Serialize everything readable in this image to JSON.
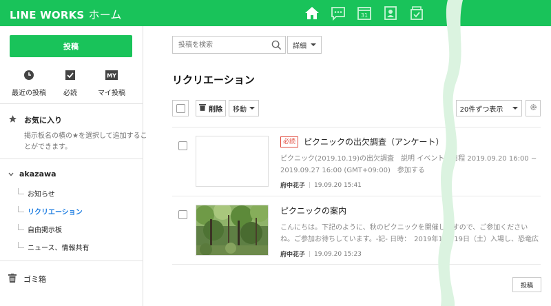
{
  "app": {
    "brand": "LINE WORKS",
    "section": "ホーム",
    "accent": "#19c35a",
    "link_color": "#1a7be0"
  },
  "topnav": [
    {
      "icon": "home-icon"
    },
    {
      "icon": "chat-icon"
    },
    {
      "icon": "calendar-icon",
      "label": "31"
    },
    {
      "icon": "contacts-icon"
    },
    {
      "icon": "task-icon"
    }
  ],
  "sidebar": {
    "post_button": "投稿",
    "quick": [
      {
        "icon": "clock-icon",
        "label": "最近の投稿"
      },
      {
        "icon": "checkbox-icon",
        "label": "必読"
      },
      {
        "icon": "my-icon",
        "icon_text": "MY",
        "label": "マイ投稿"
      }
    ],
    "favorites": {
      "title": "お気に入り",
      "description": "掲示板名の横の★を選択して追加することができます。"
    },
    "group": {
      "name": "akazawa",
      "boards": [
        "お知らせ",
        "リクリエーション",
        "自由掲示板",
        "ニュース、情報共有"
      ],
      "active_index": 1
    },
    "trash": "ゴミ箱"
  },
  "main": {
    "search": {
      "placeholder": "投稿を検索",
      "value": ""
    },
    "detail": "詳細",
    "title": "リクリエーション",
    "toolbar": {
      "delete": "削除",
      "move": "移動",
      "per_page": "20件ずつ表示"
    },
    "posts": [
      {
        "badge": "必読",
        "title": "ピクニックの出欠調査（アンケート）",
        "excerpt": "ピクニック(2019.10.19)の出欠調査　説明 イベント　日程 2019.09.20 16:00 ~ 2019.09.27 16:00 (GMT+09:00)　参加する",
        "author": "府中花子",
        "date": "19.09.20 15:41",
        "thumbnail": "blank"
      },
      {
        "badge": "",
        "title": "ピクニックの案内",
        "excerpt": "こんにちは。下記のように、秋のピクニックを開催しますので、ご参加くださいね。ご参加お待ちしています。-記- 日時：　2019年10月19日（土）入場し、恐竜広場に集合で",
        "author": "府中花子",
        "date": "19.09.20 15:23",
        "thumbnail": "forest-photo"
      }
    ],
    "submit": "投稿"
  }
}
